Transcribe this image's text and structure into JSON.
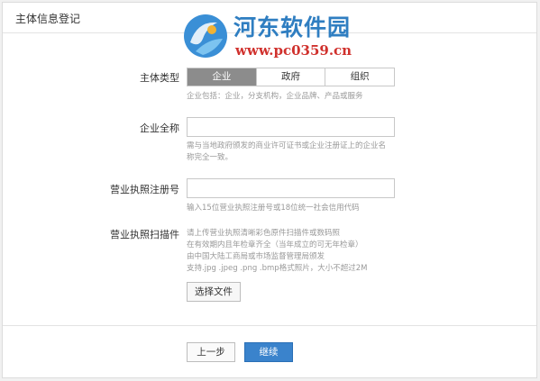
{
  "page_title": "主体信息登记",
  "watermark": {
    "name": "河东软件园",
    "url": "www.pc0359.cn"
  },
  "form": {
    "entity_type": {
      "label": "主体类型",
      "options": [
        "企业",
        "政府",
        "组织"
      ],
      "selected": "企业",
      "hint": "企业包括：企业，分支机构，企业品牌、产品或服务"
    },
    "full_name": {
      "label": "企业全称",
      "value": "",
      "hint_lines": [
        "需与当地政府颁发的商业许可证书或企业注册证上的企业名",
        "称完全一致。"
      ]
    },
    "license_no": {
      "label": "营业执照注册号",
      "value": "",
      "hint": "输入15位营业执照注册号或18位统一社会信用代码"
    },
    "license_scan": {
      "label": "营业执照扫描件",
      "hint_lines": [
        "请上传营业执照清晰彩色原件扫描件或数码照",
        "在有效期内且年检章齐全（当年成立的可无年检章）",
        "由中国大陆工商局或市场监督管理局颁发",
        "支持.jpg .jpeg .png .bmp格式照片，大小不超过2M"
      ],
      "button": "选择文件"
    }
  },
  "footer": {
    "prev": "上一步",
    "next": "继续"
  },
  "colors": {
    "primary": "#3a83cc",
    "segment_active": "#8c8c8c",
    "watermark_blue": "#2f7ec1",
    "watermark_red": "#d0312d"
  }
}
